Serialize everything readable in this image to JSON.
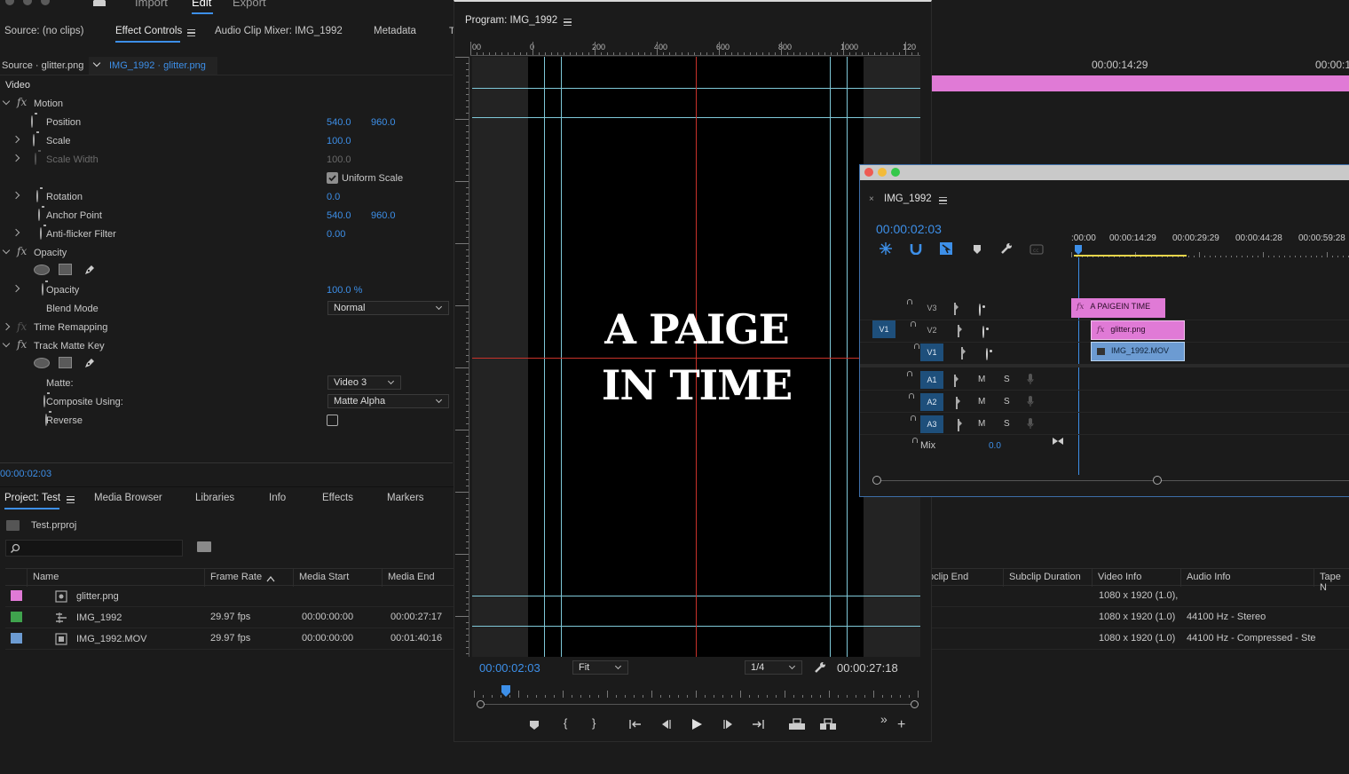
{
  "menu": {
    "import": "Import",
    "edit": "Edit",
    "export": "Export"
  },
  "source_panel": {
    "tabs": [
      "Source: (no clips)",
      "Effect Controls",
      "Audio Clip Mixer: IMG_1992",
      "Metadata"
    ],
    "source_label": "Source · glitter.png",
    "clip_label": "IMG_1992 · glitter.png",
    "video_label": "Video",
    "rows": {
      "motion": "Motion",
      "position": "Position",
      "position_x": "540.0",
      "position_y": "960.0",
      "scale": "Scale",
      "scale_val": "100.0",
      "scale_width": "Scale Width",
      "scale_width_val": "100.0",
      "uniform_scale": "Uniform Scale",
      "rotation": "Rotation",
      "rotation_val": "0.0",
      "anchor": "Anchor Point",
      "anchor_x": "540.0",
      "anchor_y": "960.0",
      "antiflicker": "Anti-flicker Filter",
      "antiflicker_val": "0.00",
      "opacity_group": "Opacity",
      "opacity": "Opacity",
      "opacity_val": "100.0 %",
      "blend_mode": "Blend Mode",
      "blend_mode_val": "Normal",
      "time_remapping": "Time Remapping",
      "track_matte": "Track Matte Key",
      "matte": "Matte:",
      "matte_val": "Video 3",
      "composite": "Composite Using:",
      "composite_val": "Matte Alpha",
      "reverse": "Reverse"
    },
    "timecode": "00:00:02:03"
  },
  "project_panel": {
    "tabs": [
      "Project: Test",
      "Media Browser",
      "Libraries",
      "Info",
      "Effects",
      "Markers"
    ],
    "project_file": "Test.prproj",
    "columns": [
      "Name",
      "Frame Rate",
      "Media Start",
      "Media End"
    ],
    "right_columns": [
      "bclip End",
      "Subclip Duration",
      "Video Info",
      "Audio Info",
      "Tape N"
    ],
    "rows": [
      {
        "name": "glitter.png",
        "frame_rate": "",
        "media_start": "",
        "media_end": "",
        "video_info": "1080 x 1920 (1.0),",
        "audio_info": "",
        "color": "#e07ad6"
      },
      {
        "name": "IMG_1992",
        "frame_rate": "29.97 fps",
        "media_start": "00:00:00:00",
        "media_end": "00:00:27:17",
        "video_info": "1080 x 1920 (1.0)",
        "audio_info": "44100 Hz - Stereo",
        "color": "#3fa34d"
      },
      {
        "name": "IMG_1992.MOV",
        "frame_rate": "29.97 fps",
        "media_start": "00:00:00:00",
        "media_end": "00:01:40:16",
        "video_info": "1080 x 1920 (1.0)",
        "audio_info": "44100 Hz - Compressed - Ste",
        "color": "#6c9bd2"
      }
    ]
  },
  "program_monitor": {
    "title": "Program: IMG_1992",
    "ruler_labels": [
      "00",
      "0",
      "200",
      "400",
      "600",
      "800",
      "1000",
      "120"
    ],
    "video_text_line1": "A PAIGE",
    "video_text_line2": "IN TIME",
    "timecode": "00:00:02:03",
    "fit": "Fit",
    "quality": "1/4",
    "duration": "00:00:27:18"
  },
  "background_timeline": {
    "timecode_a": "00:00:14:29",
    "timecode_b": "00:00:1"
  },
  "timeline": {
    "title": "IMG_1992",
    "timecode": "00:00:02:03",
    "ruler": [
      ":00:00",
      "00:00:14:29",
      "00:00:29:29",
      "00:00:44:28",
      "00:00:59:28"
    ],
    "tracks_video": [
      "V3",
      "V2",
      "V1"
    ],
    "source_patch": "V1",
    "tracks_audio": [
      "A1",
      "A2",
      "A3"
    ],
    "m": "M",
    "s": "S",
    "mix": "Mix",
    "mix_val": "0.0",
    "clips": {
      "v3": "A PAIGEIN TIME",
      "v2": "glitter.png",
      "v1": "IMG_1992.MOV"
    }
  },
  "colors": {
    "accent": "#3d8fe8",
    "graphic_clip": "#e07ad6",
    "video_clip": "#6c9bd2",
    "guide": "#7fc8d8",
    "center_guide": "#c8322a"
  }
}
